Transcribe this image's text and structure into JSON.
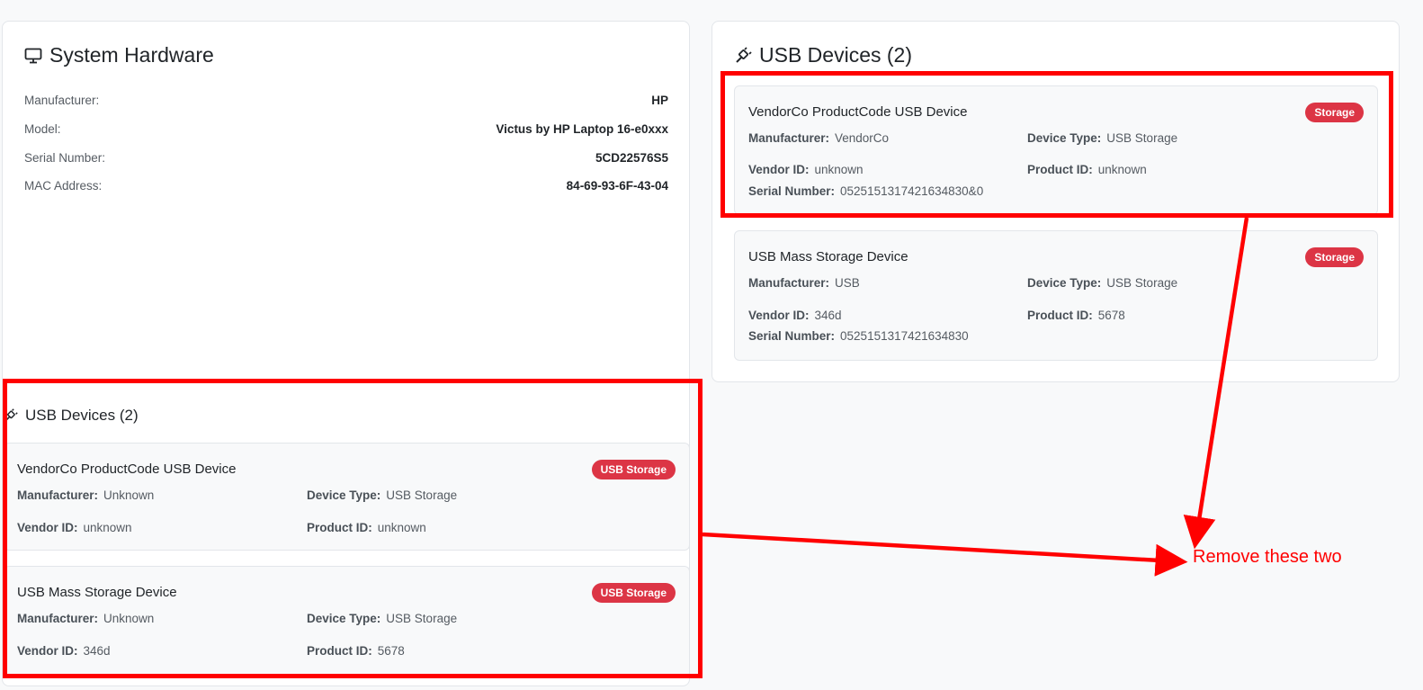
{
  "hardware": {
    "title": "System Hardware",
    "rows": [
      {
        "label": "Manufacturer:",
        "value": "HP"
      },
      {
        "label": "Model:",
        "value": "Victus by HP Laptop 16-e0xxx"
      },
      {
        "label": "Serial Number:",
        "value": "5CD22576S5"
      },
      {
        "label": "MAC Address:",
        "value": "84-69-93-6F-43-04"
      }
    ]
  },
  "usb_panel": {
    "title": "USB Devices (2)",
    "labels": {
      "manufacturer": "Manufacturer:",
      "device_type": "Device Type:",
      "vendor_id": "Vendor ID:",
      "product_id": "Product ID:",
      "serial": "Serial Number:"
    },
    "devices": [
      {
        "name": "VendorCo ProductCode USB Device",
        "badge": "Storage",
        "manufacturer": "VendorCo",
        "device_type": "USB Storage",
        "vendor_id": "unknown",
        "product_id": "unknown",
        "serial": "0525151317421634830&0"
      },
      {
        "name": "USB Mass Storage Device",
        "badge": "Storage",
        "manufacturer": "USB",
        "device_type": "USB Storage",
        "vendor_id": "346d",
        "product_id": "5678",
        "serial": "0525151317421634830"
      }
    ]
  },
  "usb_lower": {
    "title": "USB Devices (2)",
    "devices": [
      {
        "name": "VendorCo ProductCode USB Device",
        "badge": "USB Storage",
        "manufacturer": "Unknown",
        "device_type": "USB Storage",
        "vendor_id": "unknown",
        "product_id": "unknown"
      },
      {
        "name": "USB Mass Storage Device",
        "badge": "USB Storage",
        "manufacturer": "Unknown",
        "device_type": "USB Storage",
        "vendor_id": "346d",
        "product_id": "5678"
      }
    ]
  },
  "annotation": {
    "text": "Remove these two",
    "color": "#ff0000"
  },
  "colors": {
    "badge": "#dc3545",
    "page_bg": "#f8f9fa"
  },
  "icons": {
    "hardware_title": "monitor-icon",
    "usb_title": "usb-plug-icon"
  }
}
